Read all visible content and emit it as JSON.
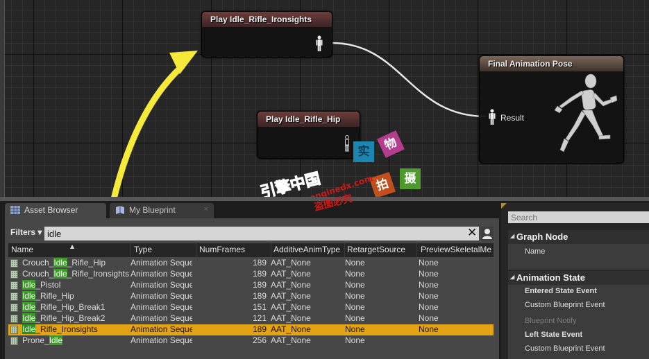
{
  "graph": {
    "nodes": {
      "ironsights": {
        "title": "Play Idle_Rifle_Ironsights"
      },
      "hip": {
        "title": "Play Idle_Rifle_Hip"
      },
      "final_pose": {
        "title": "Final Animation Pose",
        "result_label": "Result"
      }
    },
    "watermark": {
      "tiles": [
        "实",
        "物",
        "拍",
        "摄"
      ],
      "tile_colors": [
        "#1d86b0",
        "#b53d8e",
        "#c2501f",
        "#4f9a2c"
      ],
      "logo_text": "引擎中国",
      "url_text": "www.enginedx.com",
      "notice_text": "盗图必究"
    },
    "annotation_color": "#f5e93a"
  },
  "tabs": [
    {
      "label": "Asset Browser",
      "active": true
    },
    {
      "label": "My Blueprint",
      "active": false,
      "close": "×"
    }
  ],
  "asset_browser": {
    "filters_label": "Filters ▾",
    "search_value": "idle",
    "clear_icon": "✕",
    "columns": [
      "Name",
      "Type",
      "NumFrames",
      "AdditiveAnimType",
      "RetargetSource",
      "PreviewSkeletalMe"
    ],
    "rows": [
      {
        "name_pre": "Crouch_",
        "name_hl": "Idle",
        "name_post": "_Rifle_Hip",
        "type": "Animation Sequence",
        "frames": "189",
        "additive": "AAT_None",
        "retarget": "None",
        "preview": "None",
        "selected": false
      },
      {
        "name_pre": "Crouch_",
        "name_hl": "Idle",
        "name_post": "_Rifle_Ironsights",
        "type": "Animation Sequence",
        "frames": "189",
        "additive": "AAT_None",
        "retarget": "None",
        "preview": "None",
        "selected": false
      },
      {
        "name_pre": "",
        "name_hl": "Idle",
        "name_post": "_Pistol",
        "type": "Animation Sequence",
        "frames": "189",
        "additive": "AAT_None",
        "retarget": "None",
        "preview": "None",
        "selected": false
      },
      {
        "name_pre": "",
        "name_hl": "Idle",
        "name_post": "_Rifle_Hip",
        "type": "Animation Sequence",
        "frames": "189",
        "additive": "AAT_None",
        "retarget": "None",
        "preview": "None",
        "selected": false
      },
      {
        "name_pre": "",
        "name_hl": "Idle",
        "name_post": "_Rifle_Hip_Break1",
        "type": "Animation Sequence",
        "frames": "151",
        "additive": "AAT_None",
        "retarget": "None",
        "preview": "None",
        "selected": false
      },
      {
        "name_pre": "",
        "name_hl": "Idle",
        "name_post": "_Rifle_Hip_Break2",
        "type": "Animation Sequence",
        "frames": "121",
        "additive": "AAT_None",
        "retarget": "None",
        "preview": "None",
        "selected": false
      },
      {
        "name_pre": "",
        "name_hl": "Idle",
        "name_post": "_Rifle_Ironsights",
        "type": "Animation Sequence",
        "frames": "189",
        "additive": "AAT_None",
        "retarget": "None",
        "preview": "None",
        "selected": true
      },
      {
        "name_pre": "Prone_",
        "name_hl": "Idle",
        "name_post": "",
        "type": "Animation Sequence",
        "frames": "256",
        "additive": "AAT_None",
        "retarget": "None",
        "preview": "",
        "selected": false
      }
    ],
    "selection_color": "#e2a413",
    "highlight_color": "#3f9a2b"
  },
  "details": {
    "search_placeholder": "Search",
    "categories": [
      {
        "label": "Graph Node",
        "props": [
          {
            "label": "Name",
            "style": "normal"
          }
        ]
      },
      {
        "label": "Animation State",
        "props": [
          {
            "label": "Entered State Event",
            "style": "bold"
          },
          {
            "label": "Custom Blueprint Event",
            "style": "normal"
          },
          {
            "label": "Blueprint Notify",
            "style": "dim"
          },
          {
            "label": "Left State Event",
            "style": "bold"
          },
          {
            "label": "Custom Blueprint Event",
            "style": "normal"
          }
        ]
      }
    ]
  }
}
